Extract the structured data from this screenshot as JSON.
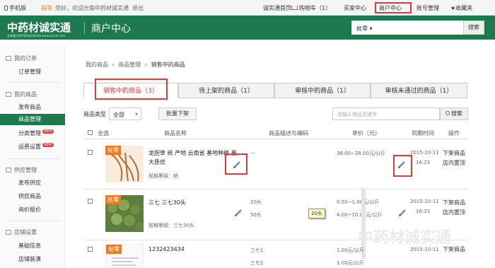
{
  "topbar": {
    "mobile": "手机版",
    "highlight": "段华",
    "welcome": "您好，欢迎光临中药材诚实通",
    "logout": "退出",
    "nav": [
      "诚实通首页",
      "购物车（1）",
      "买家中心",
      "商户中心",
      "账号管理",
      "收藏夹"
    ]
  },
  "header": {
    "logo_text": "中药材诚实通",
    "logo_sub": "全球最大的中药材交易市场 www.zyccst.com",
    "title": "商户中心",
    "search_dropdown": "批零",
    "search_button": "搜索"
  },
  "sidebar": {
    "sections": [
      {
        "title": "我的订单",
        "items": [
          {
            "label": "订单管理"
          }
        ]
      },
      {
        "title": "我的商品",
        "items": [
          {
            "label": "发布商品"
          },
          {
            "label": "商品管理"
          },
          {
            "label": "分类管理",
            "badge": "NEW"
          },
          {
            "label": "运费设置",
            "badge": "NEW"
          }
        ]
      },
      {
        "title": "供应管理",
        "items": [
          {
            "label": "发布供应"
          },
          {
            "label": "供应商品"
          },
          {
            "label": "询价报价"
          }
        ]
      },
      {
        "title": "店铺设置",
        "items": [
          {
            "label": "基础信息"
          },
          {
            "label": "店铺装潢"
          }
        ]
      }
    ]
  },
  "breadcrumb": [
    "我的商品",
    "商品管理",
    "销售中的商品"
  ],
  "breadcrumb_sep": "›",
  "tabs": [
    "销售中的商品（3）",
    "待上架的商品（1）",
    "审核中的商品（1）",
    "审核未通过的商品（1）"
  ],
  "filter": {
    "category_label": "商品类型",
    "category_value": "全部",
    "bulk_button": "批量下架",
    "search_placeholder": "请输入商品关键字",
    "search_button": "搜索"
  },
  "table": {
    "headers": [
      "全选",
      "商品名称",
      "商品描述与编码",
      "单价（元）",
      "到期时间",
      "操作"
    ],
    "rows": [
      {
        "badge": "批零",
        "title": "龙胆草 统 产地 云南省 基地种植 量大质优",
        "spec": "规格等级：统",
        "desc": [
          "—"
        ],
        "prices": [
          "36.00~38.00元/公斤"
        ],
        "date": "2015-10-11",
        "time": "16:23",
        "ops": [
          "下架商品",
          "店内置顶"
        ]
      },
      {
        "badge": "批零",
        "title": "三七 三七30头",
        "spec": "规格等级：三七30头",
        "desc": [
          "20头",
          "50头"
        ],
        "prices": [
          "0.50~1.00元/公斤",
          "4.00~10.00元/公斤"
        ],
        "date": "2015-10-11",
        "time": "16:33",
        "ops": [
          "下架商品",
          "店内置顶"
        ]
      },
      {
        "badge": "批零",
        "title": "1232423434",
        "spec": "",
        "desc": [
          "三七1",
          "三七2"
        ],
        "prices": [
          "1.00元/公斤",
          "1.00元/公斤"
        ],
        "date": "2015-10-11",
        "time": "",
        "ops": [
          "下架商品"
        ]
      }
    ]
  },
  "tooltip": "20头",
  "watermark": "中药材诚实通",
  "colors": {
    "brand_green": "#1d7a4f",
    "highlight_red": "#e4393c",
    "badge_orange": "#f07a1a"
  }
}
